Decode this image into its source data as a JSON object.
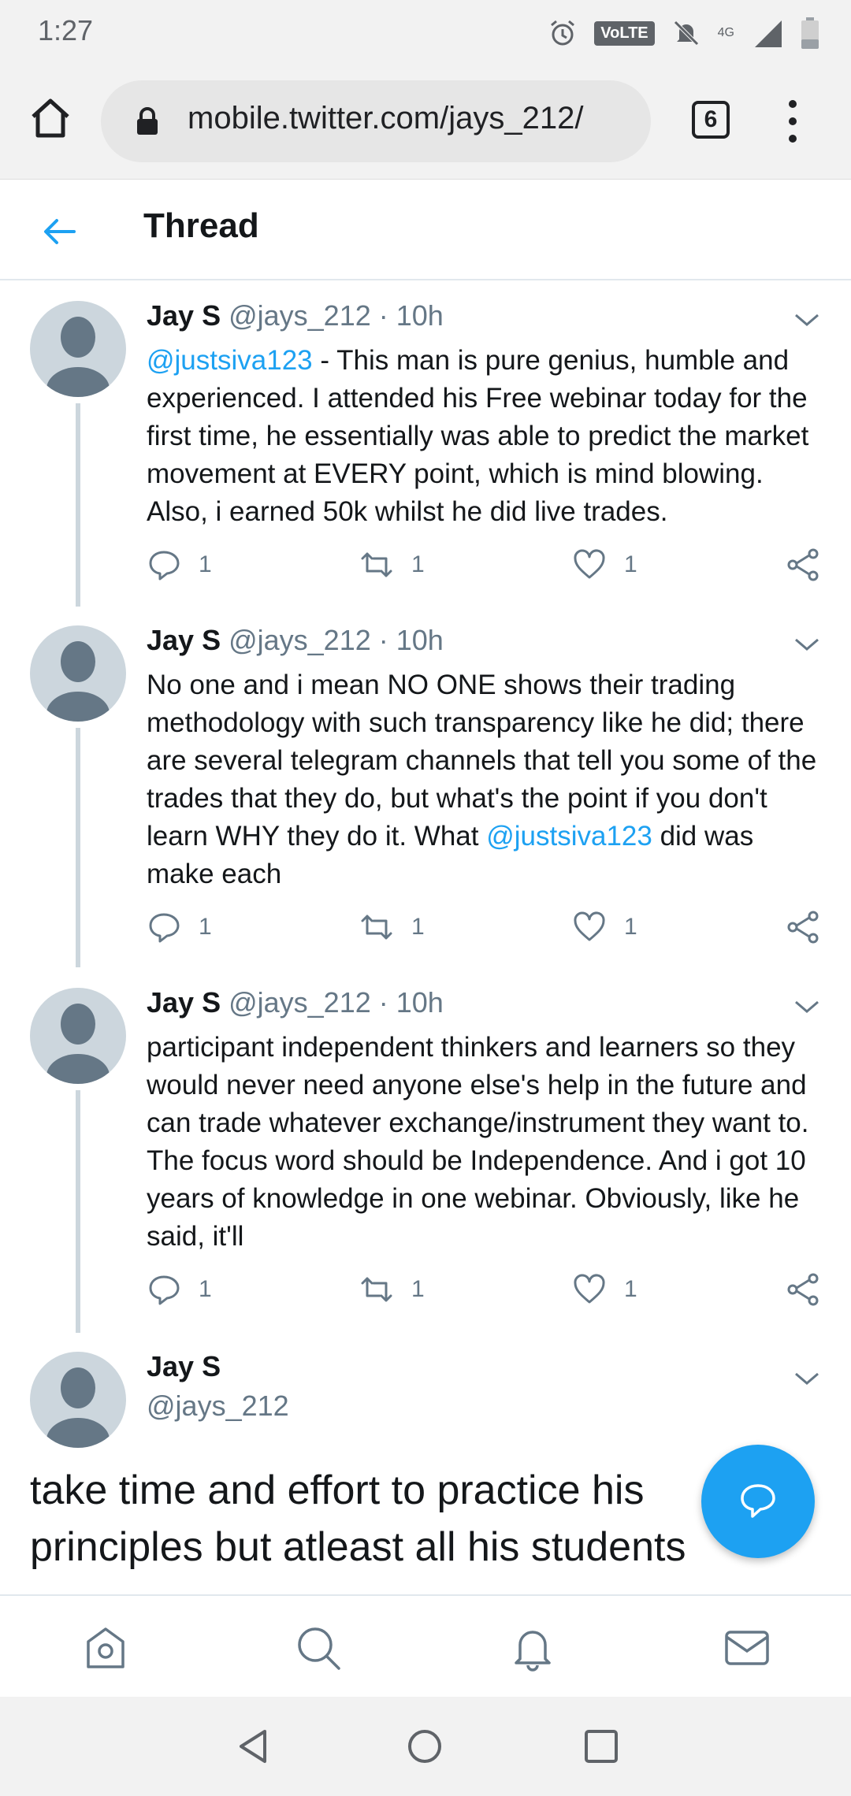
{
  "status_bar": {
    "time": "1:27",
    "volte_label": "VoLTE",
    "network_label": "4G"
  },
  "browser": {
    "url": "mobile.twitter.com/jays_212/",
    "tab_count": "6"
  },
  "header": {
    "title": "Thread"
  },
  "tweets": [
    {
      "name": "Jay S",
      "meta": " @jays_212 · 10h",
      "mention_start": "@justsiva123",
      "text": " - This man is pure genius, humble and experienced. I attended his Free webinar today for the first time, he essentially was able to predict the market movement at EVERY point, which is mind blowing. Also, i earned 50k whilst he did live trades.",
      "reply_count": "1",
      "retweet_count": "1",
      "like_count": "1"
    },
    {
      "name": "Jay S",
      "meta": " @jays_212 · 10h",
      "text_before": "No one and i mean NO ONE shows their trading methodology with such transparency like he did; there are several telegram channels that tell you some of the trades that they do, but what's the point if you don't learn WHY they do it. What ",
      "mention": "@justsiva123",
      "text_after": " did was make each",
      "reply_count": "1",
      "retweet_count": "1",
      "like_count": "1"
    },
    {
      "name": "Jay S",
      "meta": " @jays_212 · 10h",
      "text": "participant independent thinkers and learners so they would never need anyone else's help in the future and can trade whatever exchange/instrument they want to. The focus word should be Independence. And i got 10 years of knowledge in one webinar. Obviously, like he said, it'll",
      "reply_count": "1",
      "retweet_count": "1",
      "like_count": "1"
    }
  ],
  "focused_tweet": {
    "name": "Jay S",
    "handle": "@jays_212",
    "text": "take time and effort to practice his principles but atleast all his students"
  },
  "icons": {
    "reply": "reply-icon",
    "retweet": "retweet-icon",
    "like": "heart-icon",
    "share": "share-icon",
    "compose": "compose-reply-icon"
  },
  "colors": {
    "accent": "#1da1f2",
    "muted": "#657786",
    "avatar_bg": "#ccd6dd"
  }
}
